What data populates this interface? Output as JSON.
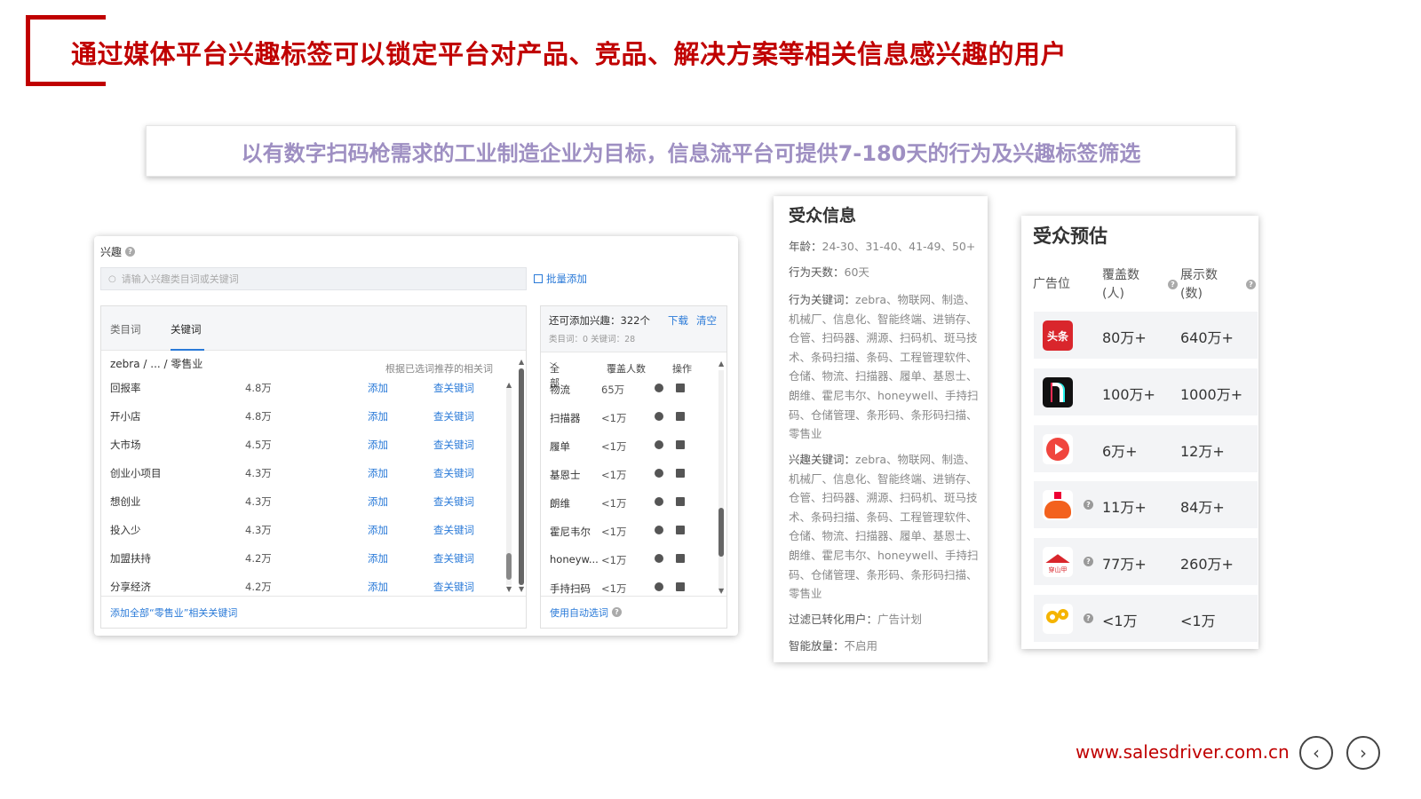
{
  "title": "通过媒体平台兴趣标签可以锁定平台对产品、竞品、解决方案等相关信息感兴趣的用户",
  "subtitle": "以有数字扫码枪需求的工业制造企业为目标，信息流平台可提供7-180天的行为及兴趣标签筛选",
  "interest_panel": {
    "label": "兴趣",
    "search_placeholder": "请输入兴趣类目词或关键词",
    "batch_add": "批量添加",
    "tabs": [
      "类目词",
      "关键词"
    ],
    "breadcrumb": "zebra / ... / 零售业",
    "hint": "根据已选词推荐的相关词",
    "rows": [
      {
        "word": "回报率",
        "count": "4.8万",
        "add": "添加",
        "related": "查关键词"
      },
      {
        "word": "开小店",
        "count": "4.8万",
        "add": "添加",
        "related": "查关键词"
      },
      {
        "word": "大市场",
        "count": "4.5万",
        "add": "添加",
        "related": "查关键词"
      },
      {
        "word": "创业小项目",
        "count": "4.3万",
        "add": "添加",
        "related": "查关键词"
      },
      {
        "word": "想创业",
        "count": "4.3万",
        "add": "添加",
        "related": "查关键词"
      },
      {
        "word": "投入少",
        "count": "4.3万",
        "add": "添加",
        "related": "查关键词"
      },
      {
        "word": "加盟扶持",
        "count": "4.2万",
        "add": "添加",
        "related": "查关键词"
      },
      {
        "word": "分享经济",
        "count": "4.2万",
        "add": "添加",
        "related": "查关键词"
      }
    ],
    "footer": "添加全部“零售业”相关关键词",
    "right": {
      "summary": "还可添加兴趣：322个",
      "download": "下载",
      "clear": "清空",
      "sub": "类目词：0   关键词：28",
      "headers": [
        "全部",
        "覆盖人数",
        "操作"
      ],
      "rows": [
        {
          "word": "物流",
          "count": "65万"
        },
        {
          "word": "扫描器",
          "count": "<1万"
        },
        {
          "word": "履单",
          "count": "<1万"
        },
        {
          "word": "基恩士",
          "count": "<1万"
        },
        {
          "word": "朗维",
          "count": "<1万"
        },
        {
          "word": "霍尼韦尔",
          "count": "<1万"
        },
        {
          "word": "honeyw...",
          "count": "<1万"
        },
        {
          "word": "手持扫码",
          "count": "<1万"
        }
      ],
      "footer": "使用自动选词"
    }
  },
  "audience_info": {
    "title": "受众信息",
    "age_label": "年龄：",
    "age": "24-30、31-40、41-49、50+",
    "days_label": "行为天数：",
    "days": "60天",
    "behavior_label": "行为关键词：",
    "behavior": "zebra、物联网、制造、机械厂、信息化、智能终端、进销存、仓管、扫码器、溯源、扫码机、斑马技术、条码扫描、条码、工程管理软件、仓储、物流、扫描器、履单、基恩士、朗维、霍尼韦尔、honeywell、手持扫码、仓储管理、条形码、条形码扫描、零售业",
    "interest_label": "兴趣关键词：",
    "interest": "zebra、物联网、制造、机械厂、信息化、智能终端、进销存、仓管、扫码器、溯源、扫码机、斑马技术、条码扫描、条码、工程管理软件、仓储、物流、扫描器、履单、基恩士、朗维、霍尼韦尔、honeywell、手持扫码、仓储管理、条形码、条形码扫描、零售业",
    "filter_label": "过滤已转化用户：",
    "filter": "广告计划",
    "smart_label": "智能放量：",
    "smart": "不启用"
  },
  "audience_estimate": {
    "title": "受众预估",
    "col_position": "广告位",
    "col_coverage": "覆盖数\n(人)",
    "col_impressions": "展示数\n(数)",
    "rows": [
      {
        "platform": "toutiao-logo",
        "logo_text": "头条",
        "coverage": "80万+",
        "impressions": "640万+"
      },
      {
        "platform": "douyin-logo",
        "logo_text": "",
        "coverage": "100万+",
        "impressions": "1000万+"
      },
      {
        "platform": "xigua-logo",
        "logo_text": "",
        "coverage": "6万+",
        "impressions": "12万+"
      },
      {
        "platform": "huoshan-logo",
        "logo_text": "",
        "coverage": "11万+",
        "impressions": "84万+"
      },
      {
        "platform": "chuanshanjia-logo",
        "logo_text": "穿山甲",
        "coverage": "77万+",
        "impressions": "260万+"
      },
      {
        "platform": "other-logo",
        "logo_text": "",
        "coverage": "<1万",
        "impressions": "<1万"
      }
    ]
  },
  "footer": {
    "website": "www.salesdriver.com.cn",
    "prev": "‹",
    "next": "›"
  },
  "colors": {
    "brand_red": "#c00000",
    "subtitle_purple": "#9e8fc2",
    "link_blue": "#2a7ad8"
  }
}
